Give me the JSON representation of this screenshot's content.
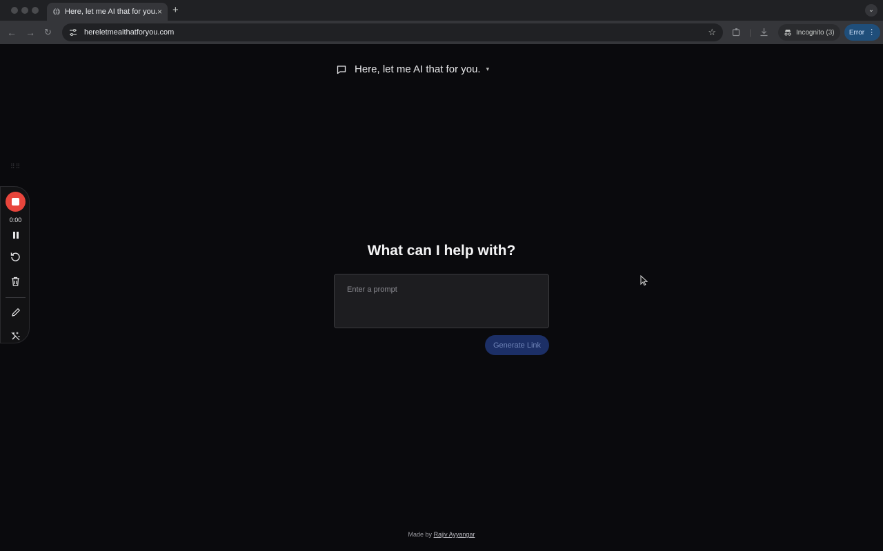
{
  "browser": {
    "tab_title": "Here, let me AI that for you.",
    "tab_close": "×",
    "new_tab": "+",
    "url": "hereletmeaithatforyou.com",
    "incognito_label": "Incognito (3)",
    "error_label": "Error"
  },
  "page": {
    "brand_title": "Here, let me AI that for you.",
    "headline": "What can I help with?",
    "prompt_placeholder": "Enter a prompt",
    "generate_label": "Generate Link",
    "footer_prefix": "Made by",
    "footer_author": "Rajiv Ayyangar"
  },
  "recorder": {
    "time": "0:00"
  },
  "colors": {
    "background": "#0a0a0d",
    "record_red": "#e8453c",
    "generate_button": "#1c2f66"
  }
}
